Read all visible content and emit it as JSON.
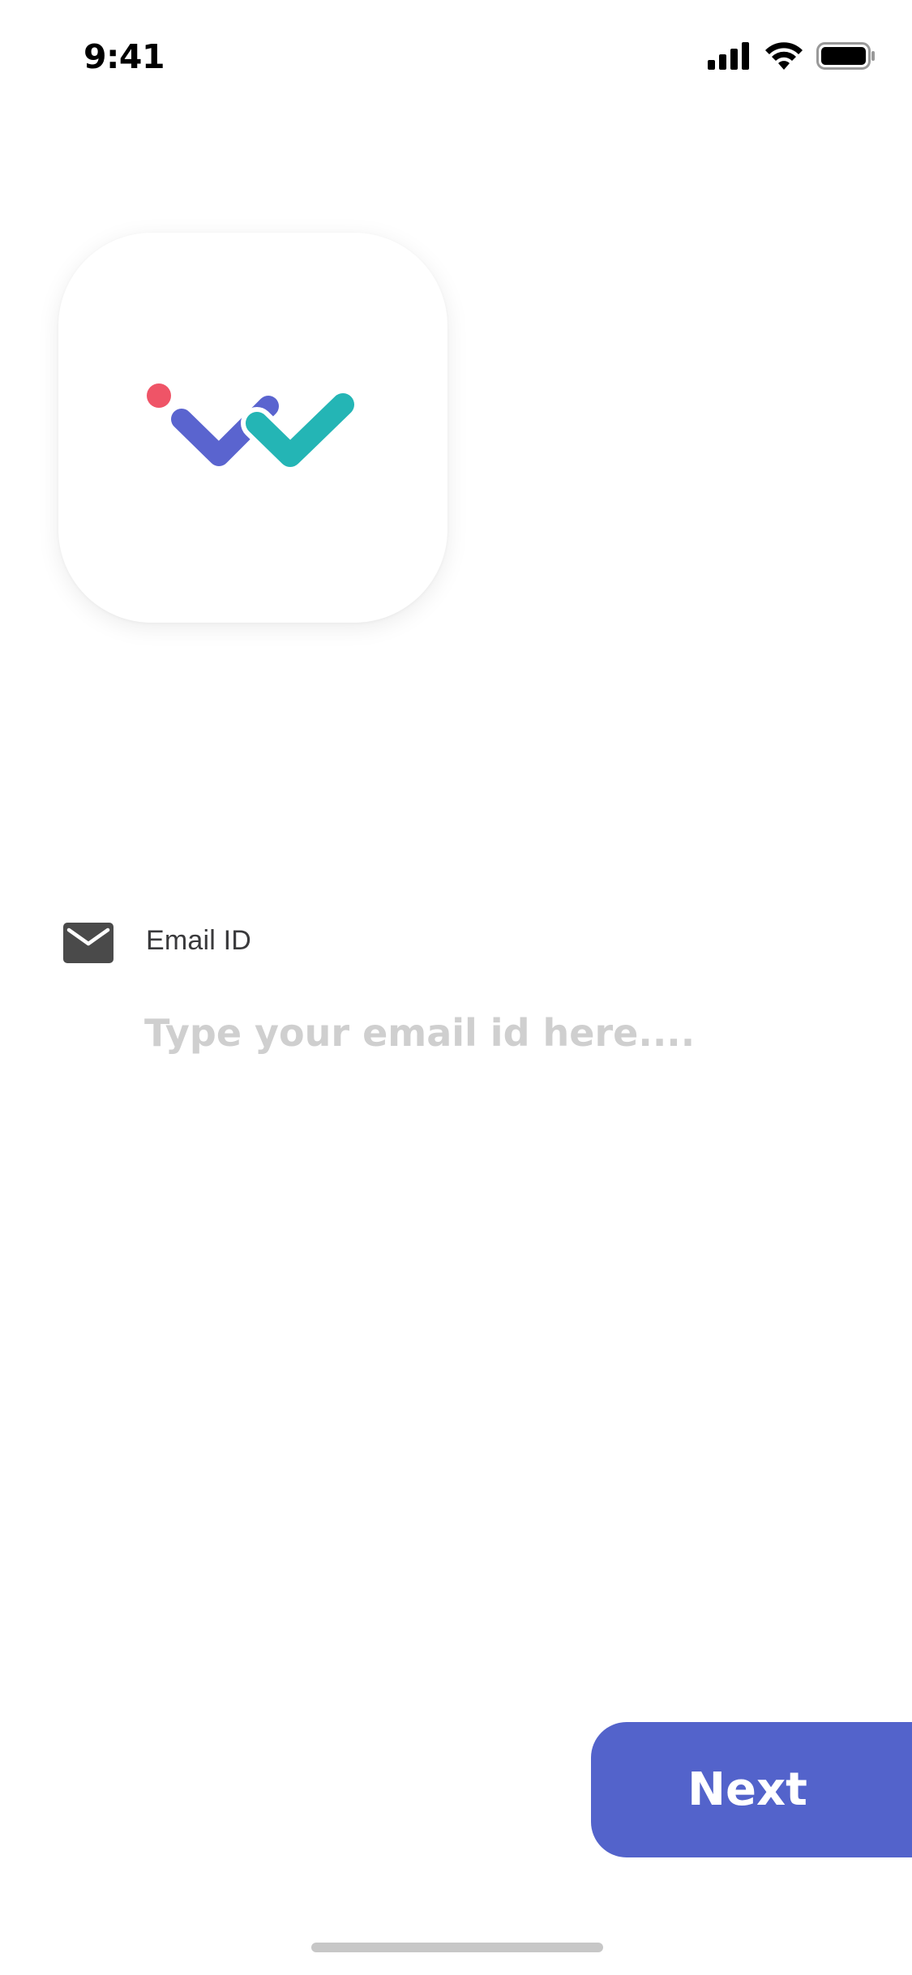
{
  "status_bar": {
    "time": "9:41",
    "icons": [
      "cellular-signal-icon",
      "wifi-icon",
      "battery-icon"
    ]
  },
  "app_icon": {
    "logo_colors": {
      "dot": "#ef5467",
      "left_check": "#5a64cf",
      "right_check": "#24b5b5"
    }
  },
  "email": {
    "icon": "mail-icon",
    "label": "Email ID",
    "placeholder": "Type your email id here....",
    "value": ""
  },
  "actions": {
    "next_label": "Next",
    "accent_color": "#5363cb"
  }
}
